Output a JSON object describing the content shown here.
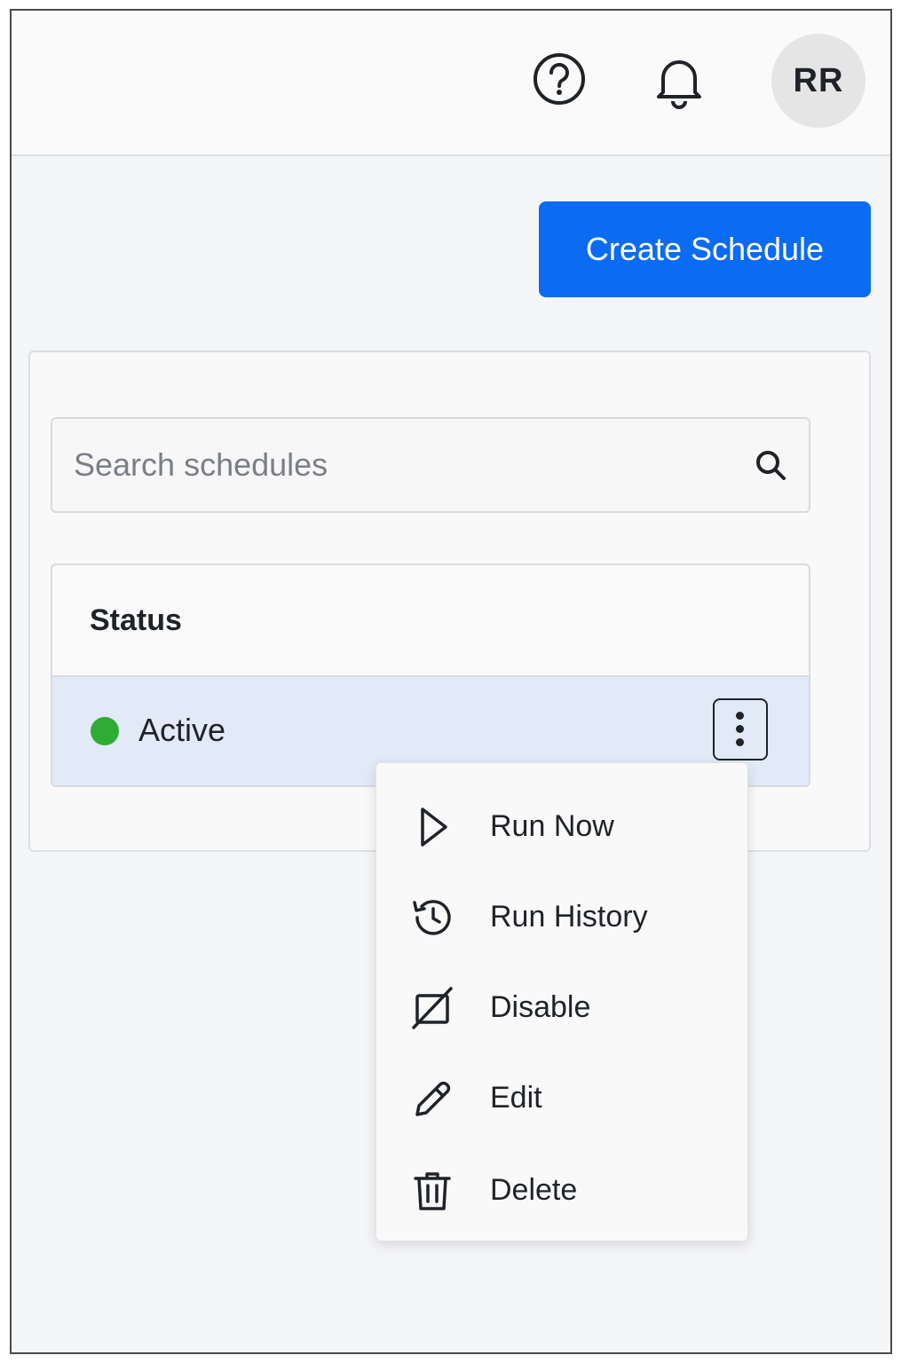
{
  "header": {
    "help_icon": "help-circle-icon",
    "notifications_icon": "bell-icon",
    "avatar_initials": "RR"
  },
  "actions": {
    "create_label": "Create Schedule",
    "create_color": "#0b6bf2"
  },
  "search": {
    "placeholder": "Search schedules",
    "value": "",
    "icon": "search-icon"
  },
  "table": {
    "columns": [
      "Status"
    ],
    "rows": [
      {
        "status": "Active",
        "status_color": "#2fac34"
      }
    ],
    "selected_row_color": "#e2eaf8"
  },
  "row_menu": {
    "items": [
      {
        "label": "Run Now",
        "icon": "play-icon"
      },
      {
        "label": "Run History",
        "icon": "history-icon"
      },
      {
        "label": "Disable",
        "icon": "disable-icon"
      },
      {
        "label": "Edit",
        "icon": "pencil-icon"
      },
      {
        "label": "Delete",
        "icon": "trash-icon"
      }
    ]
  }
}
